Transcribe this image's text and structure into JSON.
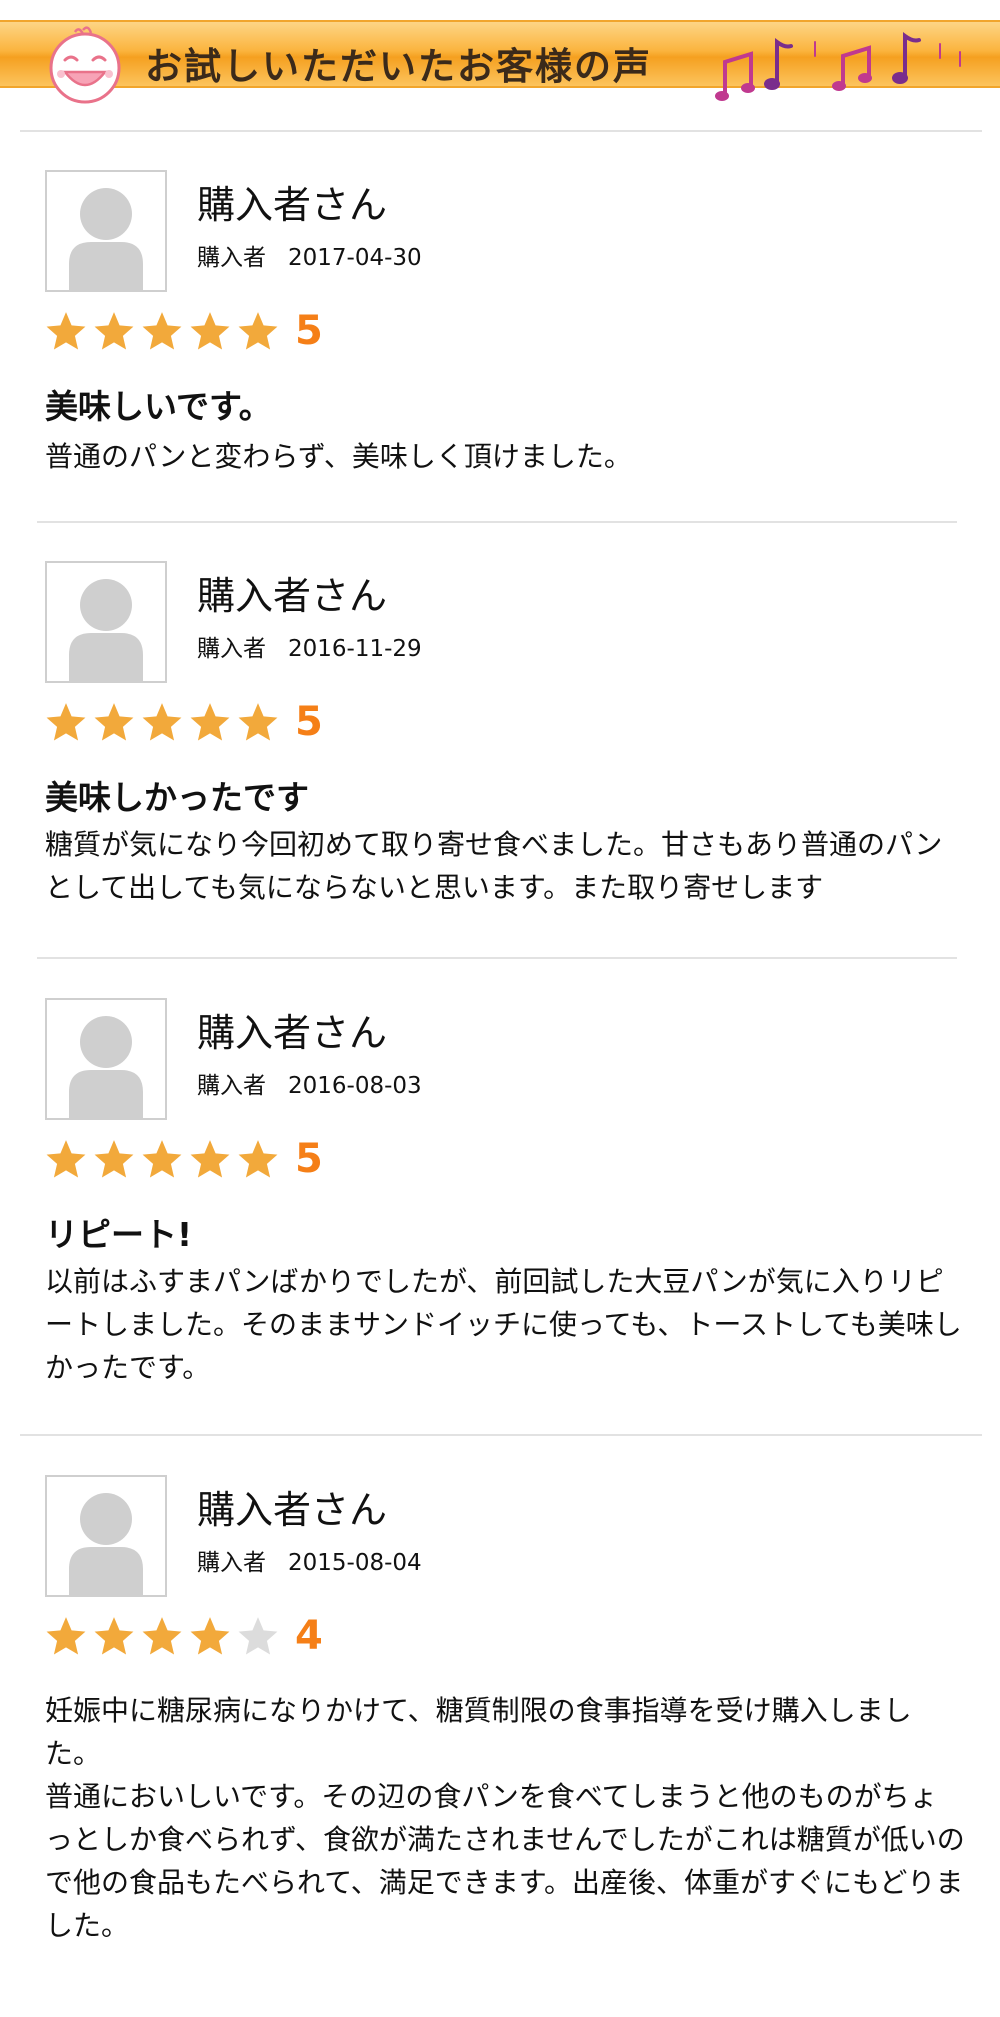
{
  "header": {
    "title": "お試しいただいたお客様の声"
  },
  "colors": {
    "star_filled": "#f2a93b",
    "star_empty": "#dcdcdc",
    "score": "#f57f17",
    "banner": "#fbb43e"
  },
  "reviews": [
    {
      "name": "購入者さん",
      "role": "購入者",
      "date": "2017-04-30",
      "rating": 5,
      "score": "5",
      "title": "美味しいです。",
      "body": [
        "普通のパンと変わらず、美味しく頂けました。"
      ]
    },
    {
      "name": "購入者さん",
      "role": "購入者",
      "date": "2016-11-29",
      "rating": 5,
      "score": "5",
      "title": "美味しかったです",
      "body": [
        "糖質が気になり今回初めて取り寄せ食べました。甘さもあり普通のパンとして出しても気にならないと思います。また取り寄せします"
      ]
    },
    {
      "name": "購入者さん",
      "role": "購入者",
      "date": "2016-08-03",
      "rating": 5,
      "score": "5",
      "title": "リピート!",
      "body": [
        "以前はふすまパンばかりでしたが、前回試した大豆パンが気に入りリピートしました。そのままサンドイッチに使っても、トーストしても美味しかったです。"
      ]
    },
    {
      "name": "購入者さん",
      "role": "購入者",
      "date": "2015-08-04",
      "rating": 4,
      "score": "4",
      "title": "",
      "body": [
        "妊娠中に糖尿病になりかけて、糖質制限の食事指導を受け購入しました。",
        "普通においしいです。その辺の食パンを食べてしまうと他のものがちょっとしか食べられず、食欲が満たされませんでしたがこれは糖質が低いので他の食品もたべられて、満足できます。出産後、体重がすぐにもどりました。"
      ]
    }
  ]
}
